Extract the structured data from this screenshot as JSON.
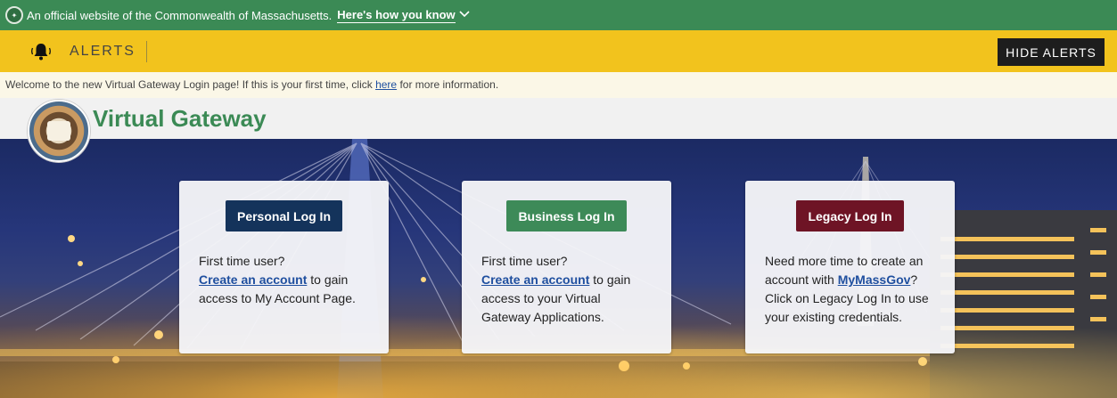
{
  "gov_banner": {
    "text": "An official website of the Commonwealth of Massachusetts.",
    "link": "Here's how you know"
  },
  "alerts": {
    "label": "ALERTS",
    "hide_button": "HIDE ALERTS"
  },
  "welcome": {
    "before": "Welcome to the new Virtual Gateway Login page! If this is your first time, click ",
    "link": "here",
    "after": " for more information."
  },
  "brand": {
    "title": "Virtual Gateway"
  },
  "cards": {
    "personal": {
      "button": "Personal Log In",
      "line1": "First time user?",
      "link": "Create an account",
      "rest": " to gain access to My Account Page."
    },
    "business": {
      "button": "Business Log In",
      "line1": "First time user?",
      "link": "Create an account",
      "rest": " to gain access to your Virtual Gateway Applications."
    },
    "legacy": {
      "button": "Legacy Log In",
      "before": "Need more time to create an account with ",
      "link": "MyMassGov",
      "rest": "? Click on Legacy Log In to use your existing credentials."
    }
  },
  "colors": {
    "gov_green": "#3b8a55",
    "alert_yellow": "#f2c31d",
    "personal_navy": "#14335b",
    "business_green": "#3d8a58",
    "legacy_maroon": "#6e1425"
  }
}
